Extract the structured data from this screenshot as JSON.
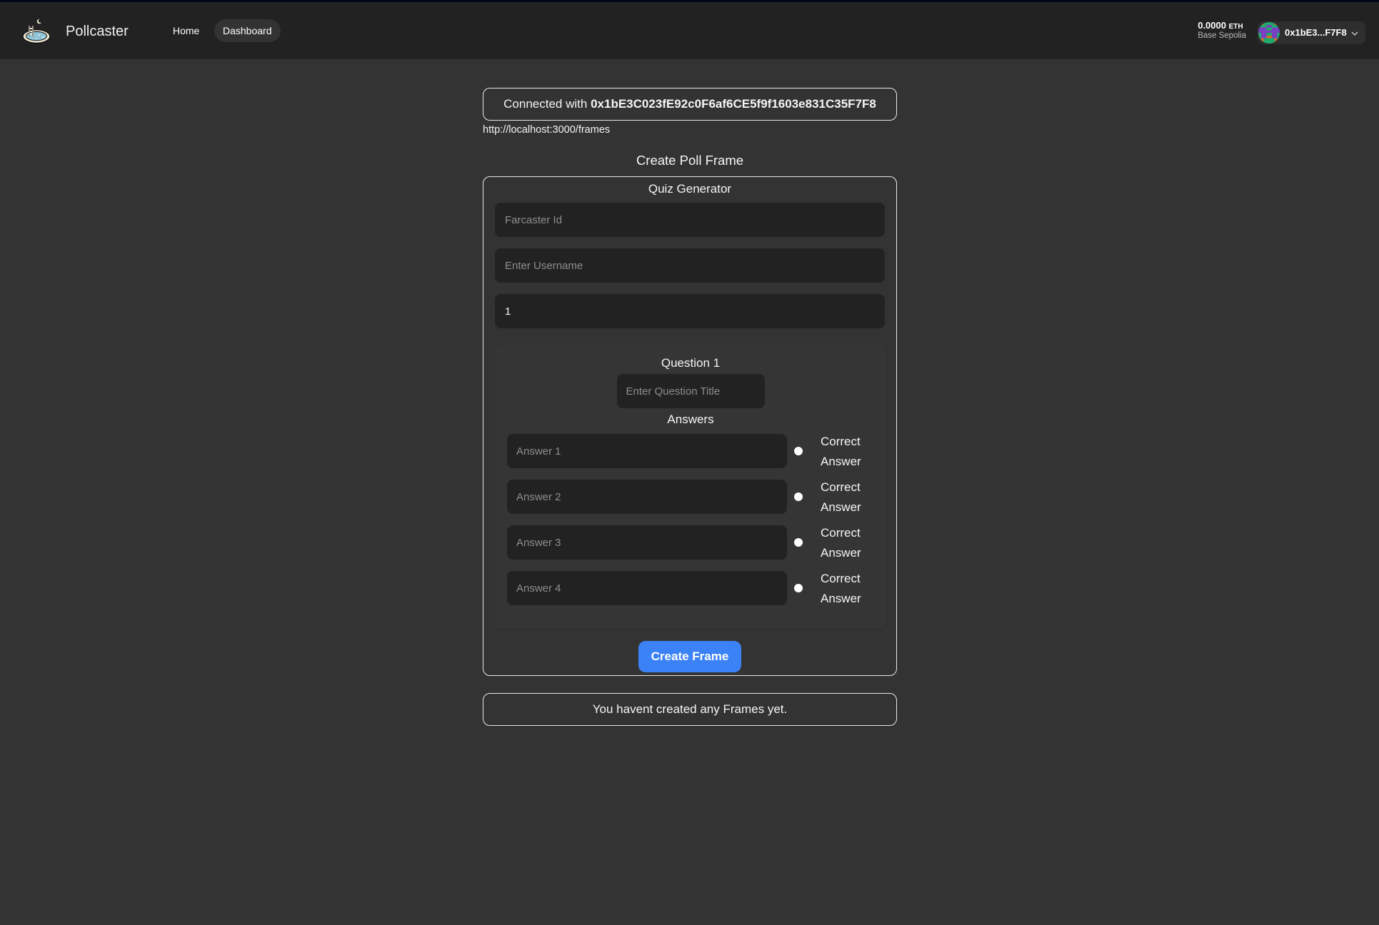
{
  "header": {
    "brand": "Pollcaster",
    "nav": [
      {
        "label": "Home",
        "active": false
      },
      {
        "label": "Dashboard",
        "active": true
      }
    ],
    "wallet": {
      "balance": "0.0000",
      "unit": "ETH",
      "network": "Base Sepolia",
      "address_short": "0x1bE3...F7F8"
    }
  },
  "connection": {
    "prefix": "Connected with",
    "address": "0x1bE3C023fE92c0F6af6CE5f9f1603e831C35F7F8",
    "url": "http://localhost:3000/frames"
  },
  "page_title": "Create Poll Frame",
  "form": {
    "title": "Quiz Generator",
    "farcaster_id": {
      "placeholder": "Farcaster Id",
      "value": ""
    },
    "username": {
      "placeholder": "Enter Username",
      "value": ""
    },
    "question_count": {
      "value": "1"
    },
    "questions": [
      {
        "label": "Question 1",
        "title_placeholder": "Enter Question Title",
        "answers_label": "Answers",
        "answers": [
          {
            "placeholder": "Answer 1",
            "correct_label": "Correct Answer",
            "selected": false
          },
          {
            "placeholder": "Answer 2",
            "correct_label": "Correct Answer",
            "selected": false
          },
          {
            "placeholder": "Answer 3",
            "correct_label": "Correct Answer",
            "selected": false
          },
          {
            "placeholder": "Answer 4",
            "correct_label": "Correct Answer",
            "selected": false
          }
        ]
      }
    ],
    "submit_label": "Create Frame"
  },
  "frames_empty_message": "You havent created any Frames yet.",
  "colors": {
    "accent": "#3b82f6",
    "background": "#333333",
    "header": "#222222",
    "input_bg": "#222222"
  }
}
